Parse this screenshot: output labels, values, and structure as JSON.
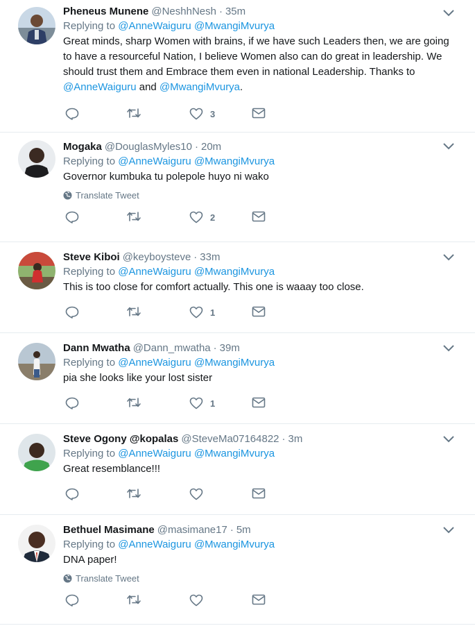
{
  "tweets": [
    {
      "fullname": "Pheneus Munene",
      "handle": "@NeshhNesh",
      "time": "35m",
      "replying_label": "Replying to",
      "replying_to": [
        "@AnneWaiguru",
        "@MwangiMvurya"
      ],
      "text_parts": [
        "Great minds, sharp Women with brains, if we have such Leaders then, we are going to have a resourceful Nation, I believe Women also can do great in leadership. We should trust them and Embrace them even in national Leadership. Thanks to ",
        "@AnneWaiguru",
        " and ",
        "@MwangiMvurya",
        "."
      ],
      "like_count": "3",
      "avatar_bg": "#c9d8e6"
    },
    {
      "fullname": "Mogaka",
      "handle": "@DouglasMyles10",
      "time": "20m",
      "replying_label": "Replying to",
      "replying_to": [
        "@AnneWaiguru",
        "@MwangiMvurya"
      ],
      "text": "Governor kumbuka tu polepole  huyo ni wako",
      "translate": "Translate Tweet",
      "like_count": "2",
      "avatar_bg": "#e9ecef"
    },
    {
      "fullname": "Steve Kiboi",
      "handle": "@keyboysteve",
      "time": "33m",
      "replying_label": "Replying to",
      "replying_to": [
        "@AnneWaiguru",
        "@MwangiMvurya"
      ],
      "text": "This is too close for comfort actually. This one is waaay too close.",
      "like_count": "1",
      "avatar_bg": "#8fb36f"
    },
    {
      "fullname": "Dann Mwatha",
      "handle": "@Dann_mwatha",
      "time": "39m",
      "replying_label": "Replying to",
      "replying_to": [
        "@AnneWaiguru",
        "@MwangiMvurya"
      ],
      "text": "pia she looks like your lost sister",
      "like_count": "1",
      "avatar_bg": "#b9c7d3"
    },
    {
      "fullname": "Steve Ogony @kopalas",
      "handle": "@SteveMa07164822",
      "time": "3m",
      "replying_label": "Replying to",
      "replying_to": [
        "@AnneWaiguru",
        "@MwangiMvurya"
      ],
      "text": "Great resemblance!!!",
      "like_count": "",
      "avatar_bg": "#dfe6ea"
    },
    {
      "fullname": "Bethuel Masimane",
      "handle": "@masimane17",
      "time": "5m",
      "replying_label": "Replying to",
      "replying_to": [
        "@AnneWaiguru",
        "@MwangiMvurya"
      ],
      "text": "DNA paper!",
      "translate": "Translate Tweet",
      "like_count": "",
      "avatar_bg": "#f2f2f2"
    }
  ],
  "icons": {
    "reply": "reply-icon",
    "retweet": "retweet-icon",
    "like": "heart-icon",
    "dm": "envelope-icon",
    "caret": "chevron-down-icon",
    "globe": "globe-icon"
  },
  "colors": {
    "link": "#1b95e0",
    "secondary": "#657786",
    "border": "#e6ecf0",
    "icon": "#657786"
  }
}
